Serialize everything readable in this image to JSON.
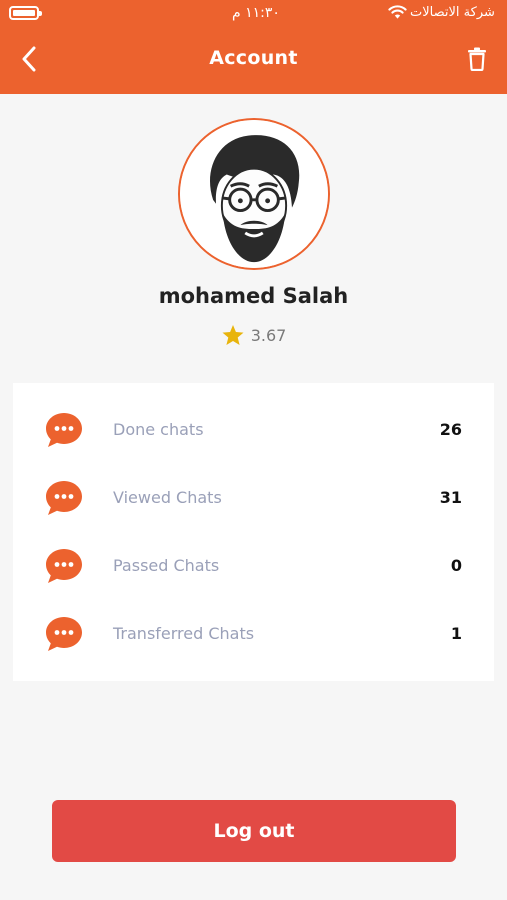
{
  "status_bar": {
    "carrier": "شركة الاتصالات",
    "time": "١١:٣٠ م"
  },
  "header": {
    "title": "Account",
    "back_icon": "chevron-left-icon",
    "trash_icon": "trash-icon"
  },
  "profile": {
    "name": "mohamed Salah",
    "rating": "3.67"
  },
  "stats": [
    {
      "label": "Done chats",
      "value": "26"
    },
    {
      "label": "Viewed Chats",
      "value": "31"
    },
    {
      "label": "Passed Chats",
      "value": "0"
    },
    {
      "label": "Transferred Chats",
      "value": "1"
    }
  ],
  "logout": {
    "label": "Log out"
  },
  "colors": {
    "primary": "#ec622e",
    "logout": "#e24a45",
    "star": "#e8b40c",
    "label": "#9aa0b8"
  }
}
